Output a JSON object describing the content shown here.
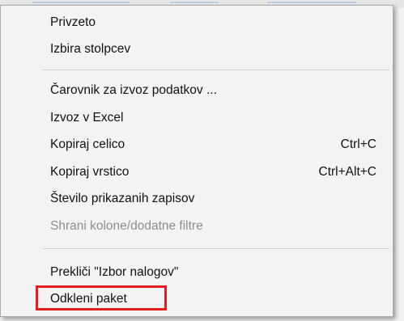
{
  "menu": {
    "items": [
      {
        "label": "Privzeto",
        "shortcut": "",
        "enabled": true
      },
      {
        "label": "Izbira stolpcev",
        "shortcut": "",
        "enabled": true
      },
      {
        "label": "Čarovnik za izvoz podatkov ...",
        "shortcut": "",
        "enabled": true
      },
      {
        "label": "Izvoz v Excel",
        "shortcut": "",
        "enabled": true
      },
      {
        "label": "Kopiraj celico",
        "shortcut": "Ctrl+C",
        "enabled": true
      },
      {
        "label": "Kopiraj vrstico",
        "shortcut": "Ctrl+Alt+C",
        "enabled": true
      },
      {
        "label": "Število prikazanih zapisov",
        "shortcut": "",
        "enabled": true
      },
      {
        "label": "Shrani kolone/dodatne filtre",
        "shortcut": "",
        "enabled": false
      },
      {
        "label": "Prekliči \"Izbor nalogov\"",
        "shortcut": "",
        "enabled": true
      },
      {
        "label": "Odkleni paket",
        "shortcut": "",
        "enabled": true
      }
    ]
  },
  "colors": {
    "highlight_border": "#e41e1e",
    "disabled_text": "#8e8e8e"
  }
}
